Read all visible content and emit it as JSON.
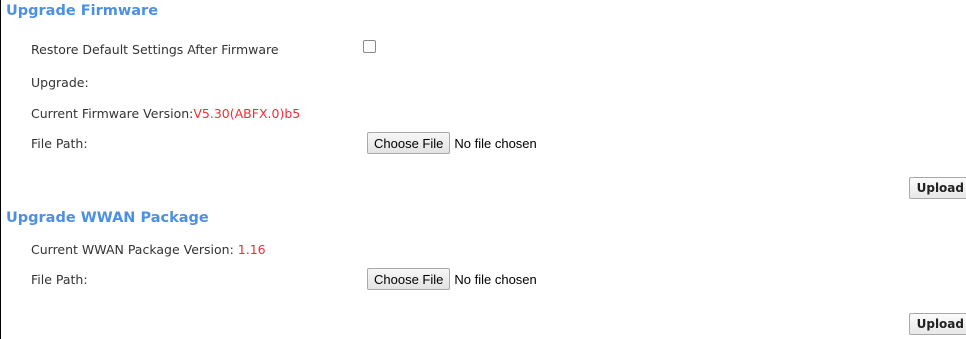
{
  "firmware": {
    "title": "Upgrade Firmware",
    "restore_label_line1": "Restore Default Settings After Firmware",
    "restore_label_line2": "Upgrade:",
    "current_version_label": "Current Firmware Version:",
    "current_version_value": "V5.30(ABFX.0)b5",
    "file_path_label": "File Path:",
    "choose_file_label": "Choose File",
    "no_file_text": "No file chosen",
    "upload_label": "Upload"
  },
  "wwan": {
    "title": "Upgrade WWAN Package",
    "current_version_label": "Current WWAN Package Version: ",
    "current_version_value": "1.16",
    "file_path_label": "File Path:",
    "choose_file_label": "Choose File",
    "no_file_text": "No file chosen",
    "upload_label": "Upload"
  },
  "colors": {
    "section_title": "#4d8fe0",
    "version_value": "#e8303a"
  }
}
